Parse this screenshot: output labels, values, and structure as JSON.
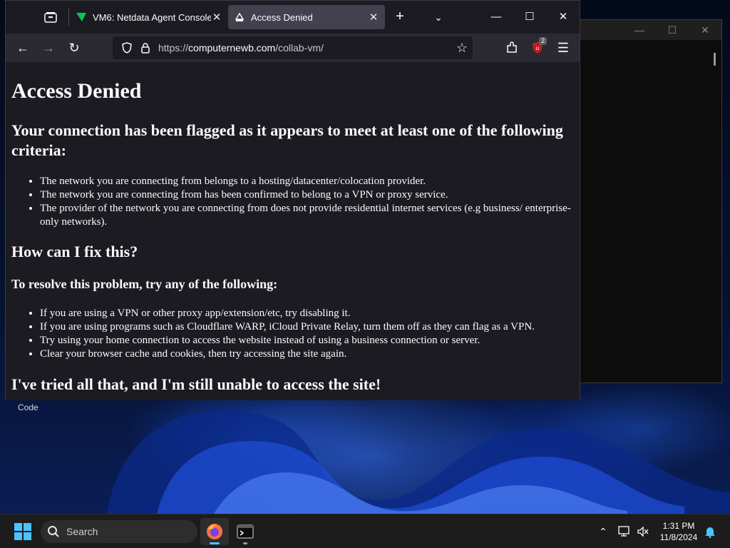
{
  "desktop": {
    "code_label": "Code"
  },
  "browser": {
    "tabs": [
      {
        "label": "VM6: Netdata Agent Console",
        "icon": "netdata-icon"
      },
      {
        "label": "Access Denied",
        "icon": "page-icon",
        "active": true
      }
    ],
    "url": {
      "prefix": "https://",
      "domain": "computernewb.com",
      "path": "/collab-vm/"
    },
    "extension_badge": "2"
  },
  "page": {
    "title": "Access Denied",
    "flagged_heading": "Your connection has been flagged as it appears to meet at least one of the following criteria:",
    "criteria": [
      "The network you are connecting from belongs to a hosting/datacenter/colocation provider.",
      "The network you are connecting from has been confirmed to belong to a VPN or proxy service.",
      "The provider of the network you are connecting from does not provide residential internet services (e.g business/ enterprise-only networks)."
    ],
    "fix_heading": "How can I fix this?",
    "resolve_heading": "To resolve this problem, try any of the following:",
    "fixes": [
      "If you are using a VPN or other proxy app/extension/etc, try disabling it.",
      "If you are using programs such as Cloudflare WARP, iCloud Private Relay, turn them off as they can flag as a VPN.",
      "Try using your home connection to access the website instead of using a business connection or server.",
      "Clear your browser cache and cookies, then try accessing the site again."
    ],
    "still_heading": "I've tried all that, and I'm still unable to access the site!"
  },
  "taskbar": {
    "search_placeholder": "Search",
    "time": "1:31 PM",
    "date": "11/8/2024"
  },
  "colors": {
    "browser_bg": "#1c1b22",
    "active_tab": "#42414d",
    "toolbar": "#2b2a33",
    "taskbar": "#1c1c1c"
  }
}
